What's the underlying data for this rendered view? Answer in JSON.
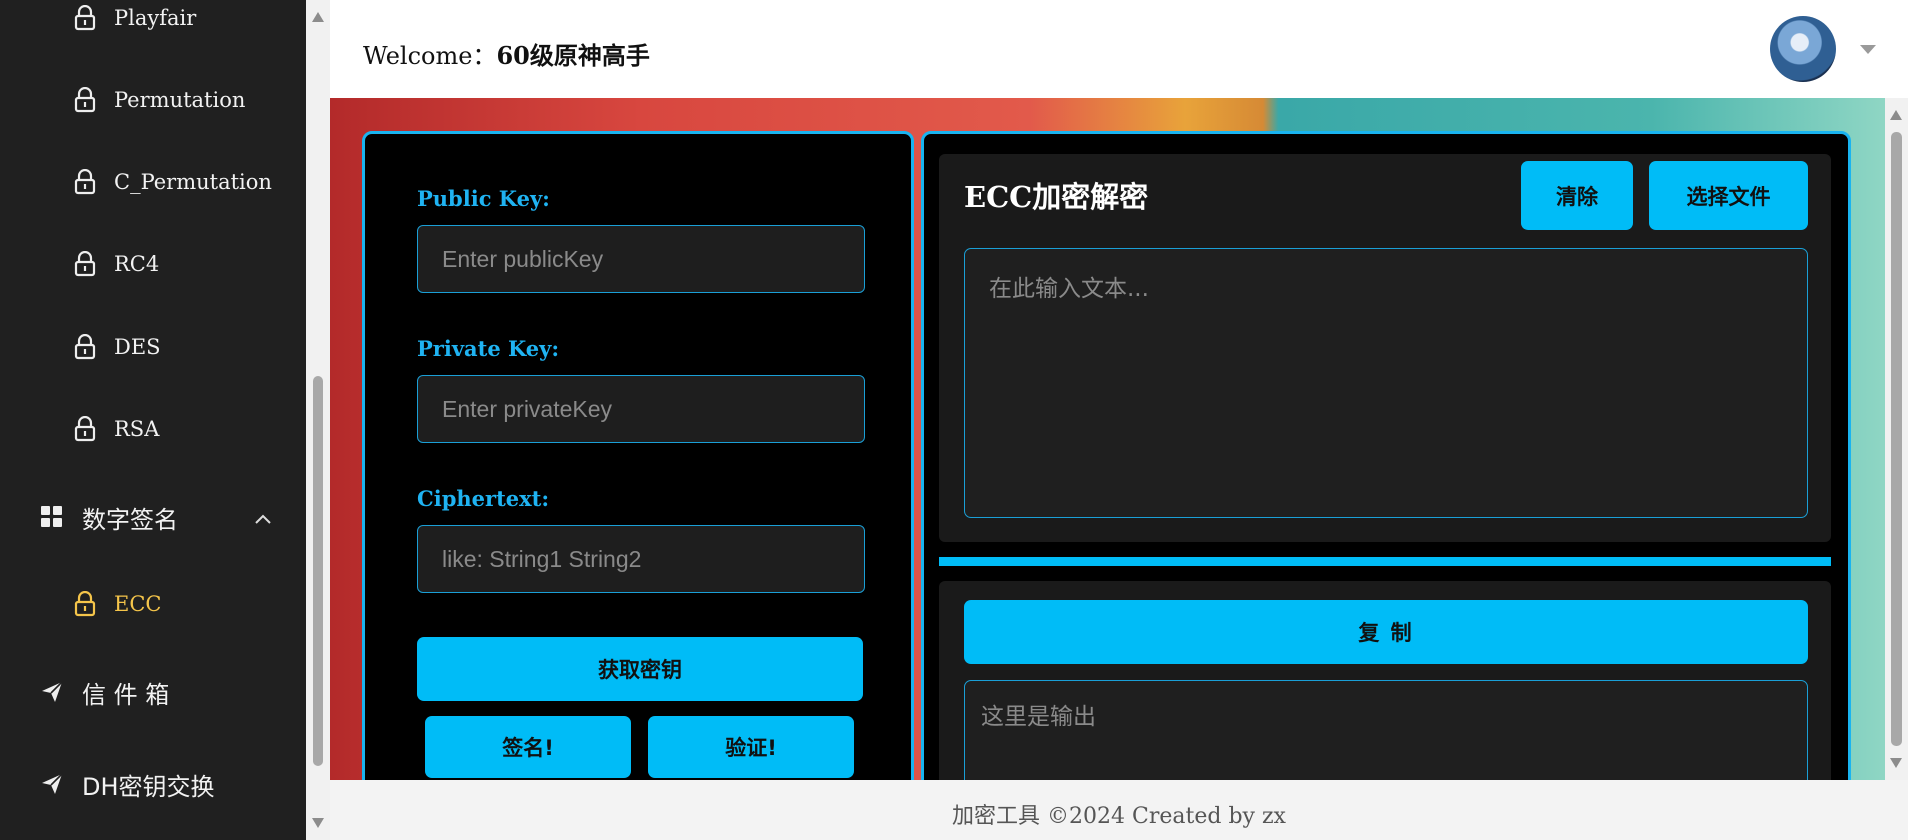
{
  "sidebar": {
    "items": [
      {
        "label": "Playfair",
        "icon": "lock-icon"
      },
      {
        "label": "Permutation",
        "icon": "lock-icon"
      },
      {
        "label": "C_Permutation",
        "icon": "lock-icon"
      },
      {
        "label": "RC4",
        "icon": "lock-icon"
      },
      {
        "label": "DES",
        "icon": "lock-icon"
      },
      {
        "label": "RSA",
        "icon": "lock-icon"
      }
    ],
    "group": {
      "label": "数字签名",
      "icon": "grid-icon",
      "expanded": true
    },
    "active_item": {
      "label": "ECC",
      "icon": "lock-icon",
      "color": "#f5c54a"
    },
    "bottom": [
      {
        "label": "信 件 箱",
        "icon": "send-icon"
      },
      {
        "label": "DH密钥交换",
        "icon": "send-icon"
      }
    ]
  },
  "header": {
    "welcome_prefix": "Welcome：",
    "username": "60级原神高手",
    "avatar_icon": "user-avatar"
  },
  "left_panel": {
    "public_key_label": "Public Key:",
    "public_key_placeholder": "Enter publicKey",
    "private_key_label": "Private Key:",
    "private_key_placeholder": "Enter privateKey",
    "ciphertext_label": "Ciphertext:",
    "ciphertext_placeholder": "like: String1 String2",
    "get_key_button": "获取密钥",
    "sign_button": "签名!",
    "verify_button": "验证!"
  },
  "right_panel": {
    "title": "ECC加密解密",
    "clear_button": "清除",
    "choose_file_button": "选择文件",
    "input_placeholder": "在此输入文本...",
    "copy_button": "复 制",
    "output_placeholder": "这里是输出"
  },
  "footer": {
    "text": "加密工具 ©2024 Created by zx"
  },
  "colors": {
    "accent": "#00bcf7",
    "sidebar_bg": "#202020",
    "active": "#f5c54a"
  }
}
